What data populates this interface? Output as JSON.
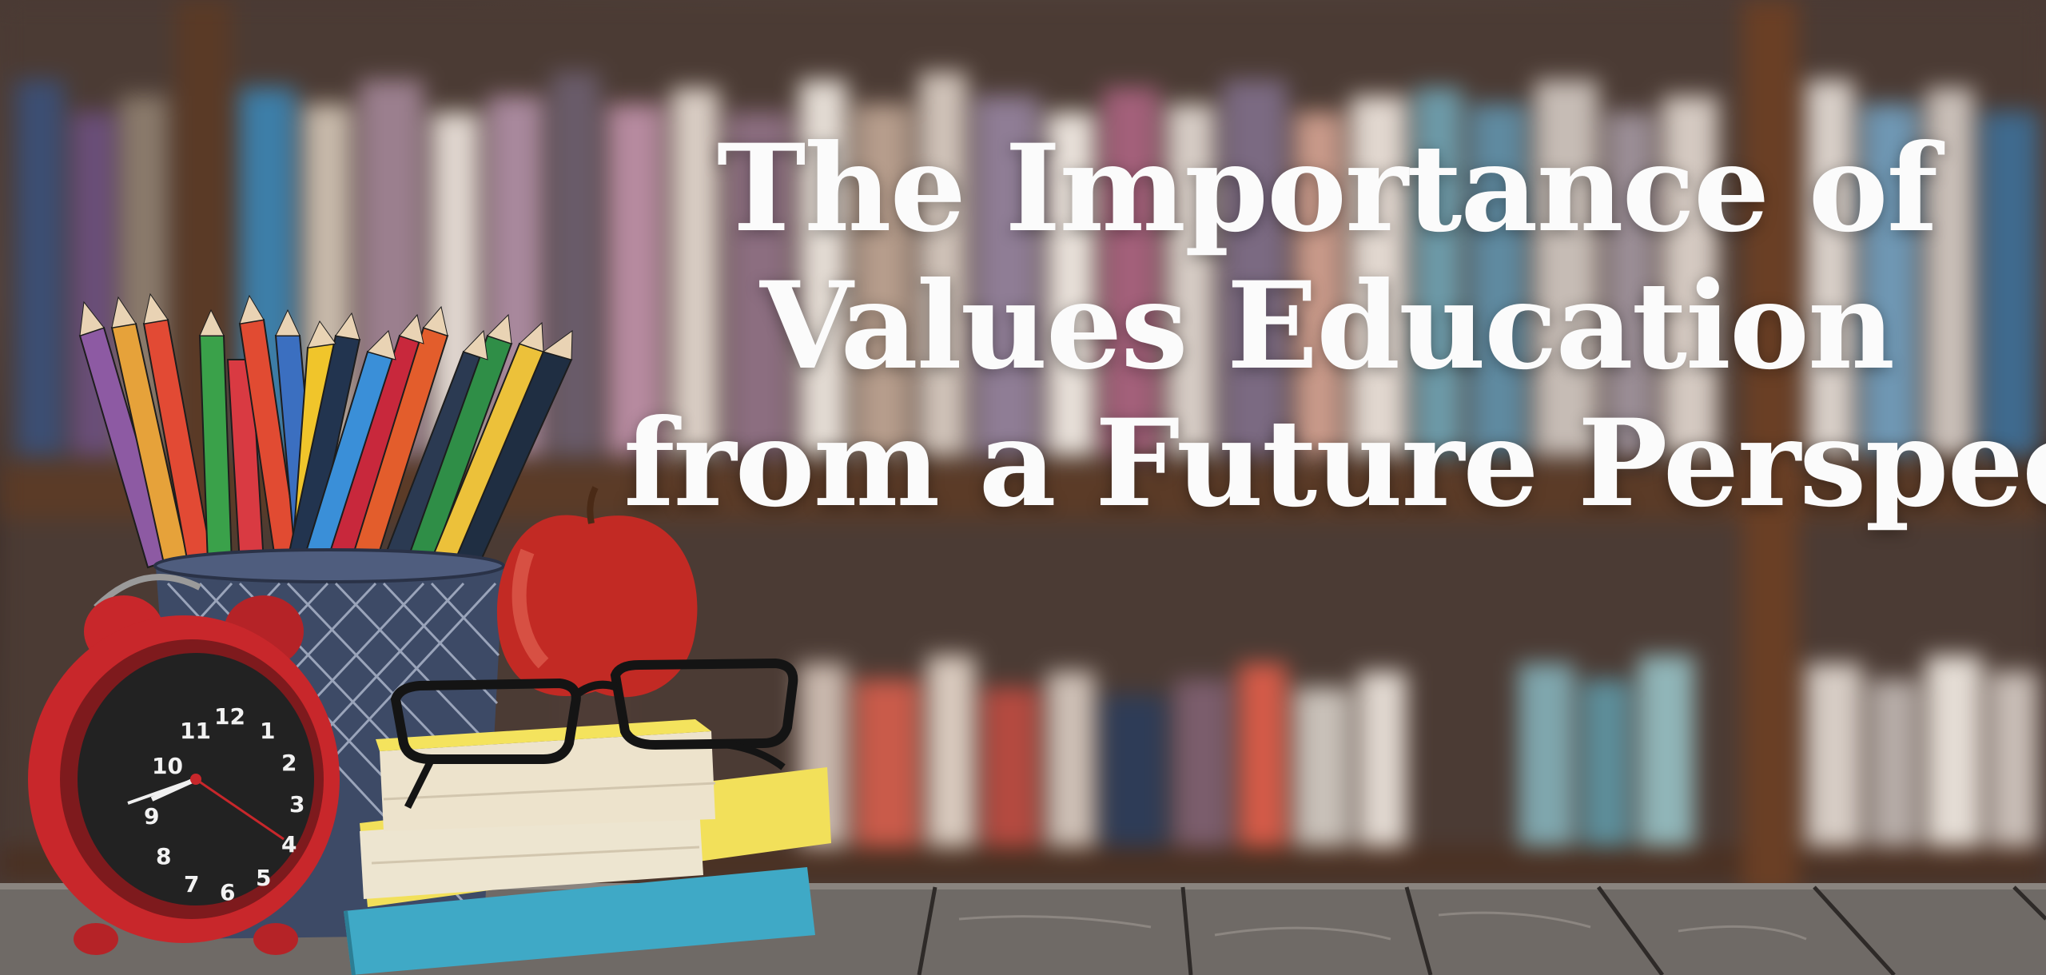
{
  "headline": {
    "line1": "The Importance of",
    "line2": "Values Education",
    "line3": "from a Future Perspective"
  },
  "clock": {
    "numerals": [
      "12",
      "1",
      "2",
      "3",
      "4",
      "5",
      "6",
      "7",
      "8",
      "9",
      "10",
      "11"
    ]
  },
  "colors": {
    "headline": "#fbfbfb",
    "clock_body": "#c8272b",
    "apple": "#c22a24",
    "table": "#6f6a66"
  },
  "objects": [
    "colored-pencils",
    "mesh-pencil-cup",
    "red-alarm-clock",
    "red-apple",
    "eyeglasses",
    "book-stack",
    "wooden-table",
    "blurred-bookshelf"
  ]
}
